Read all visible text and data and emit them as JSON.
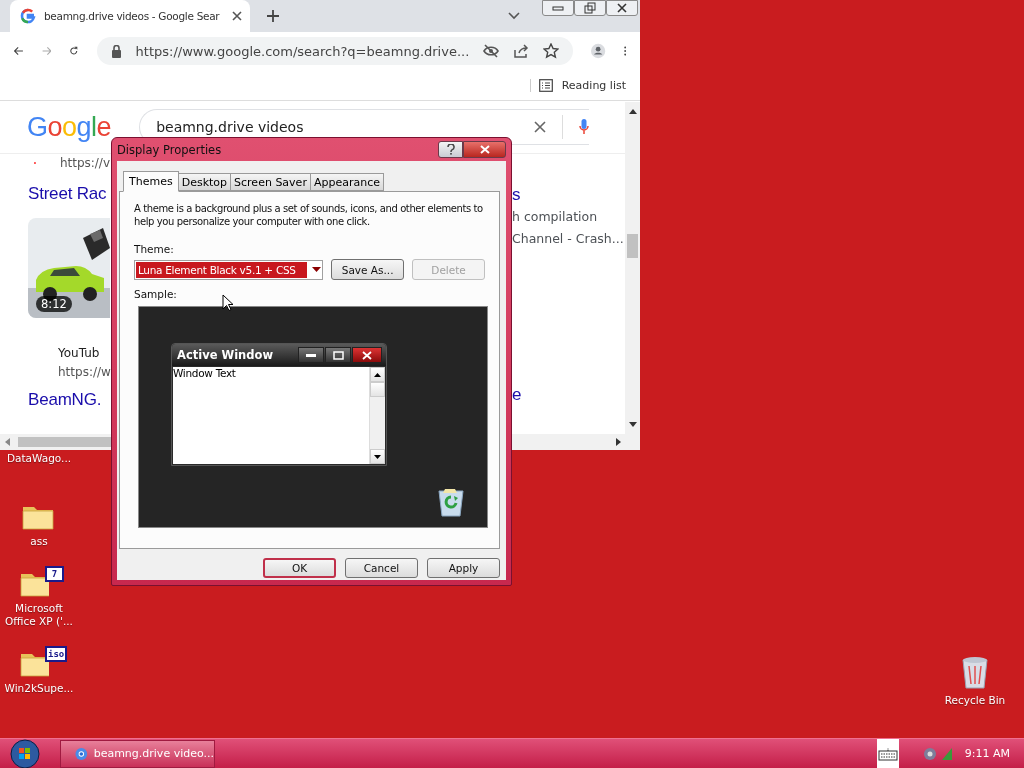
{
  "desktop": {
    "left_icons": [
      {
        "label": "DataWago...",
        "kind": "covered"
      },
      {
        "label": "ass",
        "kind": "folder"
      },
      {
        "label": "Microsoft Office XP ('...",
        "kind": "folder",
        "badge": "7"
      },
      {
        "label": "Win2kSupe...",
        "kind": "folder",
        "badge": "iso"
      }
    ],
    "right_icons": [
      {
        "label": "Recycle Bin",
        "kind": "recycle-bin"
      }
    ]
  },
  "browser": {
    "tab": {
      "title": "beamng.drive videos - Google Sear"
    },
    "url": "https://www.google.com/search?q=beamng.drive...",
    "reading_list": "Reading list",
    "logo": "Google",
    "search": {
      "value": "beamng.drive videos"
    },
    "left_results": [
      {
        "url": "https://v",
        "title": "Street Rac",
        "duration": "8:12"
      },
      {
        "source": "YouTub",
        "url": "https://w",
        "title": "BeamNG."
      }
    ],
    "right_fragments": [
      {
        "kind": "title",
        "text": "s"
      },
      {
        "kind": "snippet",
        "text": "h compilation"
      },
      {
        "kind": "snippet",
        "text": "Channel - Crash..."
      },
      {
        "kind": "title",
        "text": "e"
      }
    ]
  },
  "dialog": {
    "title": "Display Properties",
    "tabs": [
      {
        "label": "Themes",
        "selected": true
      },
      {
        "label": "Desktop",
        "selected": false
      },
      {
        "label": "Screen Saver",
        "selected": false
      },
      {
        "label": "Appearance",
        "selected": false
      }
    ],
    "description": "A theme is a background plus a set of sounds, icons, and other elements to help you personalize your computer with one click.",
    "theme_label": "Theme:",
    "theme": {
      "value": "Luna Element Black v5.1 + CSS"
    },
    "theme_buttons": [
      {
        "label": "Save As...",
        "disabled": false
      },
      {
        "label": "Delete",
        "disabled": true
      }
    ],
    "sample_label": "Sample:",
    "sample": {
      "window_title": "Active Window",
      "window_text": "Window Text"
    },
    "buttons": [
      {
        "label": "OK",
        "default": true
      },
      {
        "label": "Cancel",
        "default": false
      },
      {
        "label": "Apply",
        "default": false
      }
    ]
  },
  "taskbar": {
    "tasks": [
      {
        "label": "beamng.drive video...",
        "selected": false
      }
    ],
    "clock": "9:11 AM"
  }
}
